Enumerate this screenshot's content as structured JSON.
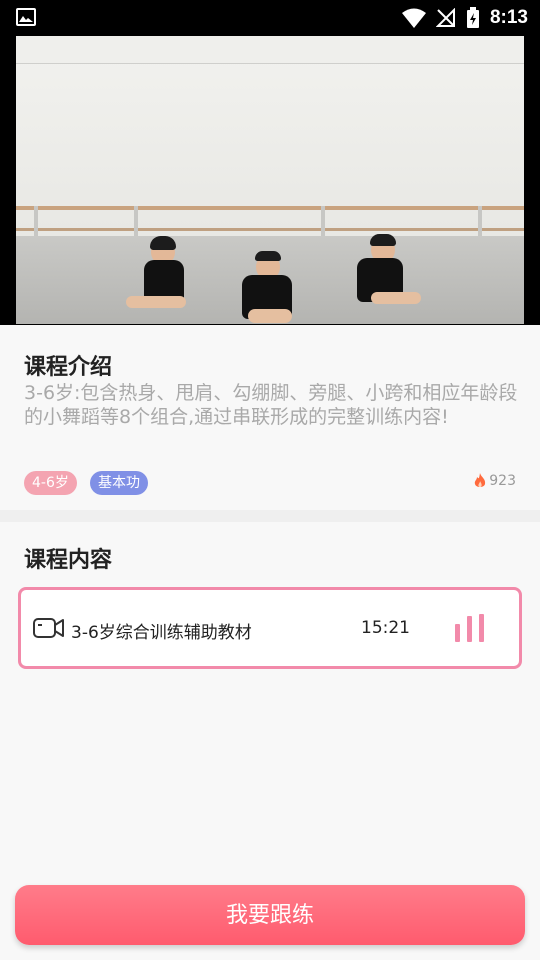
{
  "status_bar": {
    "time": "8:13",
    "icons": [
      "image-icon",
      "wifi-icon",
      "no-signal-icon",
      "battery-charging-icon"
    ]
  },
  "video": {
    "description_icon": "dance-video-thumbnail"
  },
  "intro": {
    "title": "课程介绍",
    "description": "3-6岁:包含热身、甩肩、勾绷脚、旁腿、小跨和相应年龄段的小舞蹈等8个组合,通过串联形成的完整训练内容!",
    "tags": [
      "4-6岁",
      "基本功"
    ],
    "hot_count": "923"
  },
  "content": {
    "title": "课程内容",
    "lessons": [
      {
        "name": "3-6岁综合训练辅助教材",
        "duration": "15:21"
      }
    ]
  },
  "actions": {
    "follow_label": "我要跟练"
  },
  "colors": {
    "accent_pink": "#f28aaa",
    "button_red": "#ff5b6e",
    "tag_pink": "#f4a4b1",
    "tag_blue": "#8090e6"
  }
}
